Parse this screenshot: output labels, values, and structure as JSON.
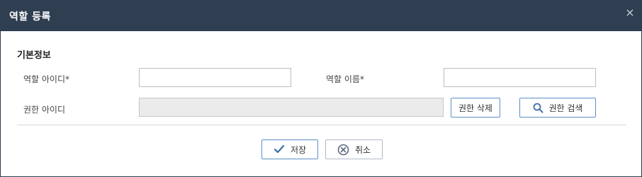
{
  "dialog": {
    "title": "역할 등록",
    "close_glyph": "×",
    "close_icon": "close-icon"
  },
  "form": {
    "section_title": "기본정보",
    "role_id_label": "역할 아이디*",
    "role_id_value": "",
    "role_name_label": "역할 이름*",
    "role_name_value": "",
    "permission_id_label": "권한 아이디",
    "permission_id_value": "",
    "delete_permission_button": "권한 삭제",
    "search_permission_button": "권한 검색",
    "search_icon": "search-icon"
  },
  "footer": {
    "save_button": "저장",
    "save_icon": "checkmark-icon",
    "cancel_button": "취소",
    "cancel_icon": "cancel-circle-icon"
  },
  "colors": {
    "titlebar": "#2f3e51",
    "button_border": "#5b8fc6",
    "readonly_bg": "#ebebeb"
  }
}
